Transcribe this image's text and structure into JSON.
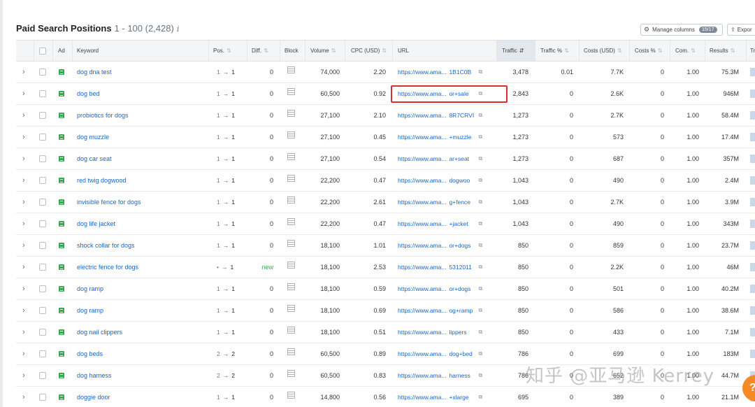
{
  "report": {
    "title": "Paid Search Positions",
    "range": "1 - 100 (2,428)",
    "info_icon": "info-icon"
  },
  "toolbar": {
    "manage_columns_label": "Manage columns",
    "manage_columns_badge": "15/17",
    "export_label": "Expor"
  },
  "columns": {
    "ad": "Ad",
    "keyword": "Keyword",
    "pos": "Pos.",
    "diff": "Diff.",
    "block": "Block",
    "volume": "Volume",
    "cpc": "CPC (USD)",
    "url": "URL",
    "traffic": "Traffic",
    "traffic_pct": "Traffic %",
    "costs": "Costs (USD)",
    "costs_pct": "Costs %",
    "com": "Com.",
    "results": "Results",
    "trend": "Tr"
  },
  "rows": [
    {
      "keyword": "dog dna test",
      "pos_from": "1",
      "pos_to": "1",
      "diff": "0",
      "volume": "74,000",
      "cpc": "2.20",
      "url": "https://www.ama...",
      "url_tail": "1B1C0B",
      "traffic": "3,478",
      "traffic_pct": "0.01",
      "costs": "7.7K",
      "costs_pct": "0",
      "com": "1.00",
      "results": "75.3M"
    },
    {
      "keyword": "dog bed",
      "pos_from": "1",
      "pos_to": "1",
      "diff": "0",
      "volume": "60,500",
      "cpc": "0.92",
      "url": "https://www.ama...",
      "url_tail": "or+sale",
      "traffic": "2,843",
      "traffic_pct": "0",
      "costs": "2.6K",
      "costs_pct": "0",
      "com": "1.00",
      "results": "946M"
    },
    {
      "keyword": "probiotics for dogs",
      "pos_from": "1",
      "pos_to": "1",
      "diff": "0",
      "volume": "27,100",
      "cpc": "2.10",
      "url": "https://www.ama...",
      "url_tail": "8R7CRVI",
      "traffic": "1,273",
      "traffic_pct": "0",
      "costs": "2.7K",
      "costs_pct": "0",
      "com": "1.00",
      "results": "58.4M"
    },
    {
      "keyword": "dog muzzle",
      "pos_from": "1",
      "pos_to": "1",
      "diff": "0",
      "volume": "27,100",
      "cpc": "0.45",
      "url": "https://www.ama...",
      "url_tail": "+muzzle",
      "traffic": "1,273",
      "traffic_pct": "0",
      "costs": "573",
      "costs_pct": "0",
      "com": "1.00",
      "results": "17.4M"
    },
    {
      "keyword": "dog car seat",
      "pos_from": "1",
      "pos_to": "1",
      "diff": "0",
      "volume": "27,100",
      "cpc": "0.54",
      "url": "https://www.ama...",
      "url_tail": "ar+seat",
      "traffic": "1,273",
      "traffic_pct": "0",
      "costs": "687",
      "costs_pct": "0",
      "com": "1.00",
      "results": "357M"
    },
    {
      "keyword": "red twig dogwood",
      "pos_from": "1",
      "pos_to": "1",
      "diff": "0",
      "volume": "22,200",
      "cpc": "0.47",
      "url": "https://www.ama...",
      "url_tail": "dogwoo",
      "traffic": "1,043",
      "traffic_pct": "0",
      "costs": "490",
      "costs_pct": "0",
      "com": "1.00",
      "results": "2.4M"
    },
    {
      "keyword": "invisible fence for dogs",
      "pos_from": "1",
      "pos_to": "1",
      "diff": "0",
      "volume": "22,200",
      "cpc": "2.61",
      "url": "https://www.ama...",
      "url_tail": "g+fence",
      "traffic": "1,043",
      "traffic_pct": "0",
      "costs": "2.7K",
      "costs_pct": "0",
      "com": "1.00",
      "results": "3.9M"
    },
    {
      "keyword": "dog life jacket",
      "pos_from": "1",
      "pos_to": "1",
      "diff": "0",
      "volume": "22,200",
      "cpc": "0.47",
      "url": "https://www.ama...",
      "url_tail": "+jacket",
      "traffic": "1,043",
      "traffic_pct": "0",
      "costs": "490",
      "costs_pct": "0",
      "com": "1.00",
      "results": "343M"
    },
    {
      "keyword": "shock collar for dogs",
      "pos_from": "1",
      "pos_to": "1",
      "diff": "0",
      "volume": "18,100",
      "cpc": "1.01",
      "url": "https://www.ama...",
      "url_tail": "or+dogs",
      "traffic": "850",
      "traffic_pct": "0",
      "costs": "859",
      "costs_pct": "0",
      "com": "1.00",
      "results": "23.7M"
    },
    {
      "keyword": "electric fence for dogs",
      "pos_from": "•",
      "pos_to": "1",
      "diff": "new",
      "volume": "18,100",
      "cpc": "2.53",
      "url": "https://www.ama...",
      "url_tail": "5312011",
      "traffic": "850",
      "traffic_pct": "0",
      "costs": "2.2K",
      "costs_pct": "0",
      "com": "1.00",
      "results": "46M"
    },
    {
      "keyword": "dog ramp",
      "pos_from": "1",
      "pos_to": "1",
      "diff": "0",
      "volume": "18,100",
      "cpc": "0.59",
      "url": "https://www.ama...",
      "url_tail": "or+dogs",
      "traffic": "850",
      "traffic_pct": "0",
      "costs": "501",
      "costs_pct": "0",
      "com": "1.00",
      "results": "40.2M"
    },
    {
      "keyword": "dog ramp",
      "pos_from": "1",
      "pos_to": "1",
      "diff": "0",
      "volume": "18,100",
      "cpc": "0.69",
      "url": "https://www.ama...",
      "url_tail": "og+ramp",
      "traffic": "850",
      "traffic_pct": "0",
      "costs": "586",
      "costs_pct": "0",
      "com": "1.00",
      "results": "38.6M"
    },
    {
      "keyword": "dog nail clippers",
      "pos_from": "1",
      "pos_to": "1",
      "diff": "0",
      "volume": "18,100",
      "cpc": "0.51",
      "url": "https://www.ama...",
      "url_tail": "lippers",
      "traffic": "850",
      "traffic_pct": "0",
      "costs": "433",
      "costs_pct": "0",
      "com": "1.00",
      "results": "7.1M"
    },
    {
      "keyword": "dog beds",
      "pos_from": "2",
      "pos_to": "2",
      "diff": "0",
      "volume": "60,500",
      "cpc": "0.89",
      "url": "https://www.ama...",
      "url_tail": "dog+bed",
      "traffic": "786",
      "traffic_pct": "0",
      "costs": "699",
      "costs_pct": "0",
      "com": "1.00",
      "results": "183M"
    },
    {
      "keyword": "dog harness",
      "pos_from": "2",
      "pos_to": "2",
      "diff": "0",
      "volume": "60,500",
      "cpc": "0.83",
      "url": "https://www.ama...",
      "url_tail": "harness",
      "traffic": "786",
      "traffic_pct": "0",
      "costs": "652",
      "costs_pct": "0",
      "com": "1.00",
      "results": "44.7M"
    },
    {
      "keyword": "doggie door",
      "pos_from": "1",
      "pos_to": "1",
      "diff": "0",
      "volume": "14,800",
      "cpc": "0.56",
      "url": "https://www.ama...",
      "url_tail": "+xlarge",
      "traffic": "695",
      "traffic_pct": "0",
      "costs": "389",
      "costs_pct": "0",
      "com": "1.00",
      "results": "21.1M"
    }
  ],
  "watermark": "知乎 @亚马逊 Kerrey",
  "help": {
    "label": "?"
  },
  "colors": {
    "link": "#1a66c9",
    "ad_icon": "#3aa853",
    "highlight": "#d9302b",
    "help_button": "#f28a26"
  }
}
